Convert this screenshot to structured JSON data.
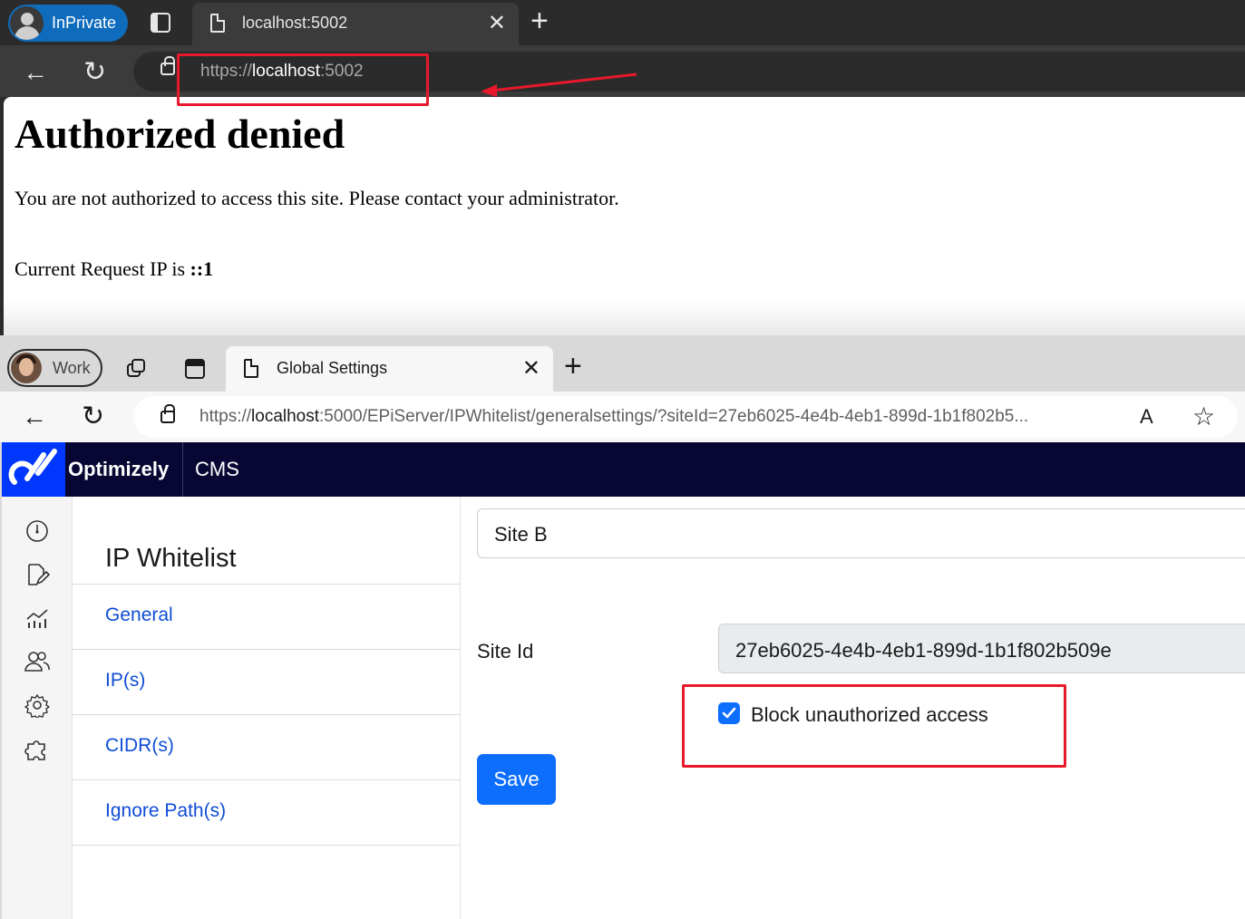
{
  "top_browser": {
    "profile_label": "InPrivate",
    "tab_title": "localhost:5002",
    "url_scheme": "https://",
    "url_host": "localhost",
    "url_port": ":5002",
    "close_glyph": "✕",
    "newtab_glyph": "+",
    "back_glyph": "←",
    "reload_glyph": "↻"
  },
  "top_page": {
    "heading": "Authorized denied",
    "message": "You are not authorized to access this site. Please contact your administrator.",
    "ip_prefix": "Current Request IP is ",
    "ip_value": "::1"
  },
  "bottom_browser": {
    "profile_label": "Work",
    "tab_title": "Global Settings",
    "url_scheme": "https://",
    "url_host": "localhost",
    "url_rest": ":5000/EPiServer/IPWhitelist/generalsettings/?siteId=27eb6025-4e4b-4eb1-899d-1b1f802b5...",
    "close_glyph": "✕",
    "newtab_glyph": "+",
    "back_glyph": "←",
    "reload_glyph": "↻",
    "readaloud_glyph": "A",
    "favorite_glyph": "☆"
  },
  "cms": {
    "brand": "Optimizely",
    "product": "CMS",
    "rail_icons": [
      "dashboard-icon",
      "edit-icon",
      "reports-icon",
      "users-icon",
      "settings-icon",
      "addons-icon"
    ],
    "subnav_title": "IP Whitelist",
    "subnav_items": [
      "General",
      "IP(s)",
      "CIDR(s)",
      "Ignore Path(s)"
    ],
    "site_selected": "Site B",
    "site_id_label": "Site Id",
    "site_id_value": "27eb6025-4e4b-4eb1-899d-1b1f802b509e",
    "block_label": "Block unauthorized access",
    "block_checked": true,
    "save_label": "Save"
  },
  "colors": {
    "annotation_red": "#e8192c",
    "cms_header": "#080733",
    "opti_blue": "#0037ff",
    "primary": "#0d6efd",
    "link": "#0f4dd6"
  }
}
